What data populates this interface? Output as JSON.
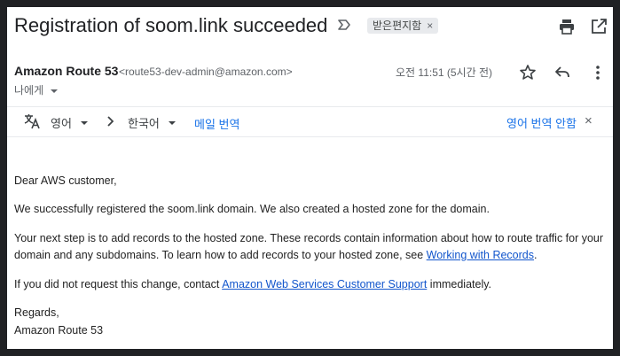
{
  "header": {
    "subject": "Registration of soom.link succeeded",
    "label": "받은편지함",
    "label_close": "×"
  },
  "sender": {
    "name": "Amazon Route 53",
    "email": "<route53-dev-admin@amazon.com>",
    "to": "나에게",
    "time": "오전 11:51 (5시간 전)"
  },
  "translate": {
    "source_lang": "영어",
    "target_lang": "한국어",
    "translate_message": "메일 번역",
    "dont_translate": "영어 번역 안함",
    "close": "×"
  },
  "body": {
    "greeting": "Dear AWS customer,",
    "p1": "We successfully registered the soom.link domain. We also created a hosted zone for the domain.",
    "p2_text": "Your next step is to add records to the hosted zone. These records contain information about how to route traffic for your domain and any subdomains. To learn how to add records to your hosted zone, see ",
    "p2_link": "Working with Records",
    "p2_end": ".",
    "p3_text": "If you did not request this change, contact ",
    "p3_link": "Amazon Web Services Customer Support",
    "p3_end": " immediately.",
    "regards": "Regards,",
    "signature": "Amazon Route 53"
  },
  "icons": [
    "importance-icon",
    "print-icon",
    "open-in-new-window-icon",
    "star-icon",
    "reply-icon",
    "more-vert-icon",
    "translate-icon",
    "dropdown-icon",
    "chevron-right-icon"
  ],
  "colors": {
    "link": "#1155cc",
    "accent": "#1a73e8",
    "text": "#202124",
    "muted": "#5f6368",
    "label_bg": "#e8eaed",
    "outer_bg": "#202124"
  }
}
